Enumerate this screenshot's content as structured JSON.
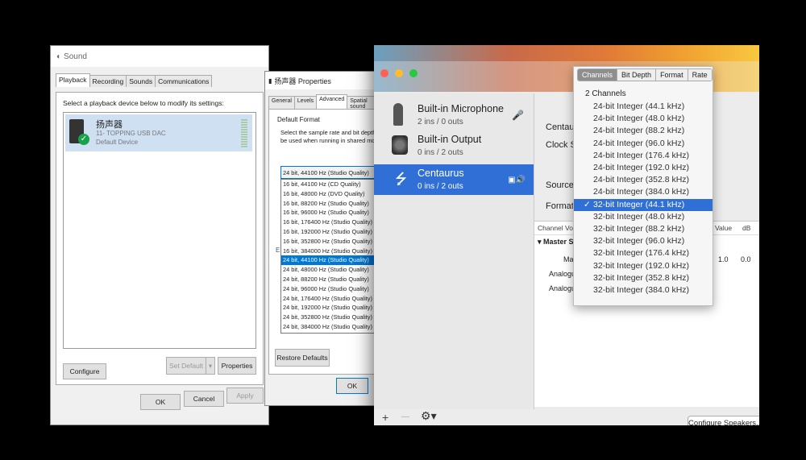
{
  "sound": {
    "title": "Sound",
    "tabs": [
      "Playback",
      "Recording",
      "Sounds",
      "Communications"
    ],
    "instruction": "Select a playback device below to modify its settings:",
    "device": {
      "name": "扬声器",
      "line2": "11- TOPPING USB DAC",
      "line3": "Default Device"
    },
    "buttons": {
      "configure": "Configure",
      "set_default": "Set Default",
      "properties": "Properties",
      "ok": "OK",
      "cancel": "Cancel",
      "apply": "Apply"
    }
  },
  "props": {
    "title": "扬声器 Properties",
    "tabs": [
      "General",
      "Levels",
      "Advanced",
      "Spatial sound"
    ],
    "group_label": "Default Format",
    "description": "Select the sample rate and bit depth to be used when running in shared mode.",
    "selected_format": "24 bit, 44100 Hz (Studio Quality)",
    "options": [
      "16 bit, 44100 Hz (CD Quality)",
      "16 bit, 48000 Hz (DVD Quality)",
      "16 bit, 88200 Hz (Studio Quality)",
      "16 bit, 96000 Hz (Studio Quality)",
      "16 bit, 176400 Hz (Studio Quality)",
      "16 bit, 192000 Hz (Studio Quality)",
      "16 bit, 352800 Hz (Studio Quality)",
      "16 bit, 384000 Hz (Studio Quality)",
      "24 bit, 44100 Hz (Studio Quality)",
      "24 bit, 48000 Hz (Studio Quality)",
      "24 bit, 88200 Hz (Studio Quality)",
      "24 bit, 96000 Hz (Studio Quality)",
      "24 bit, 176400 Hz (Studio Quality)",
      "24 bit, 192000 Hz (Studio Quality)",
      "24 bit, 352800 Hz (Studio Quality)",
      "24 bit, 384000 Hz (Studio Quality)"
    ],
    "selected_index": 8,
    "restore_defaults": "Restore Defaults",
    "ok": "OK"
  },
  "mac": {
    "devices": [
      {
        "name": "Built-in Microphone",
        "sub": "2 ins / 0 outs",
        "icon": "microphone-icon"
      },
      {
        "name": "Built-in Output",
        "sub": "0 ins / 2 outs",
        "icon": "speaker-icon"
      },
      {
        "name": "Centaurus",
        "sub": "0 ins / 2 outs",
        "icon": "usb-icon"
      }
    ],
    "selected_device": 2,
    "right_labels": {
      "device": "Centau",
      "clock": "Clock S",
      "source": "Source",
      "format": "Format"
    },
    "table": {
      "channel_vol": "Channel Vol",
      "value": "Value",
      "db": "dB",
      "master": "Master S",
      "mas": "Mas",
      "mas_value": "1.0",
      "mas_db": "0.0",
      "analog1": "Analogu",
      "analog2": "Analogu"
    },
    "configure_speakers": "Configure Speakers...",
    "bottom": {
      "add": "+",
      "remove": "—",
      "gear": "⚙"
    }
  },
  "popup": {
    "segments": [
      "Channels",
      "Bit Depth",
      "Format",
      "Rate"
    ],
    "active_segment": 0,
    "header": "2 Channels",
    "items": [
      "24-bit Integer (44.1 kHz)",
      "24-bit Integer (48.0 kHz)",
      "24-bit Integer (88.2 kHz)",
      "24-bit Integer (96.0 kHz)",
      "24-bit Integer (176.4 kHz)",
      "24-bit Integer (192.0 kHz)",
      "24-bit Integer (352.8 kHz)",
      "24-bit Integer (384.0 kHz)",
      "32-bit Integer (44.1 kHz)",
      "32-bit Integer (48.0 kHz)",
      "32-bit Integer (88.2 kHz)",
      "32-bit Integer (96.0 kHz)",
      "32-bit Integer (176.4 kHz)",
      "32-bit Integer (192.0 kHz)",
      "32-bit Integer (352.8 kHz)",
      "32-bit Integer (384.0 kHz)"
    ],
    "selected_index": 8,
    "check": "✓"
  },
  "colors": {
    "win_select": "#0078d7",
    "mac_select": "#2f6fd6"
  }
}
